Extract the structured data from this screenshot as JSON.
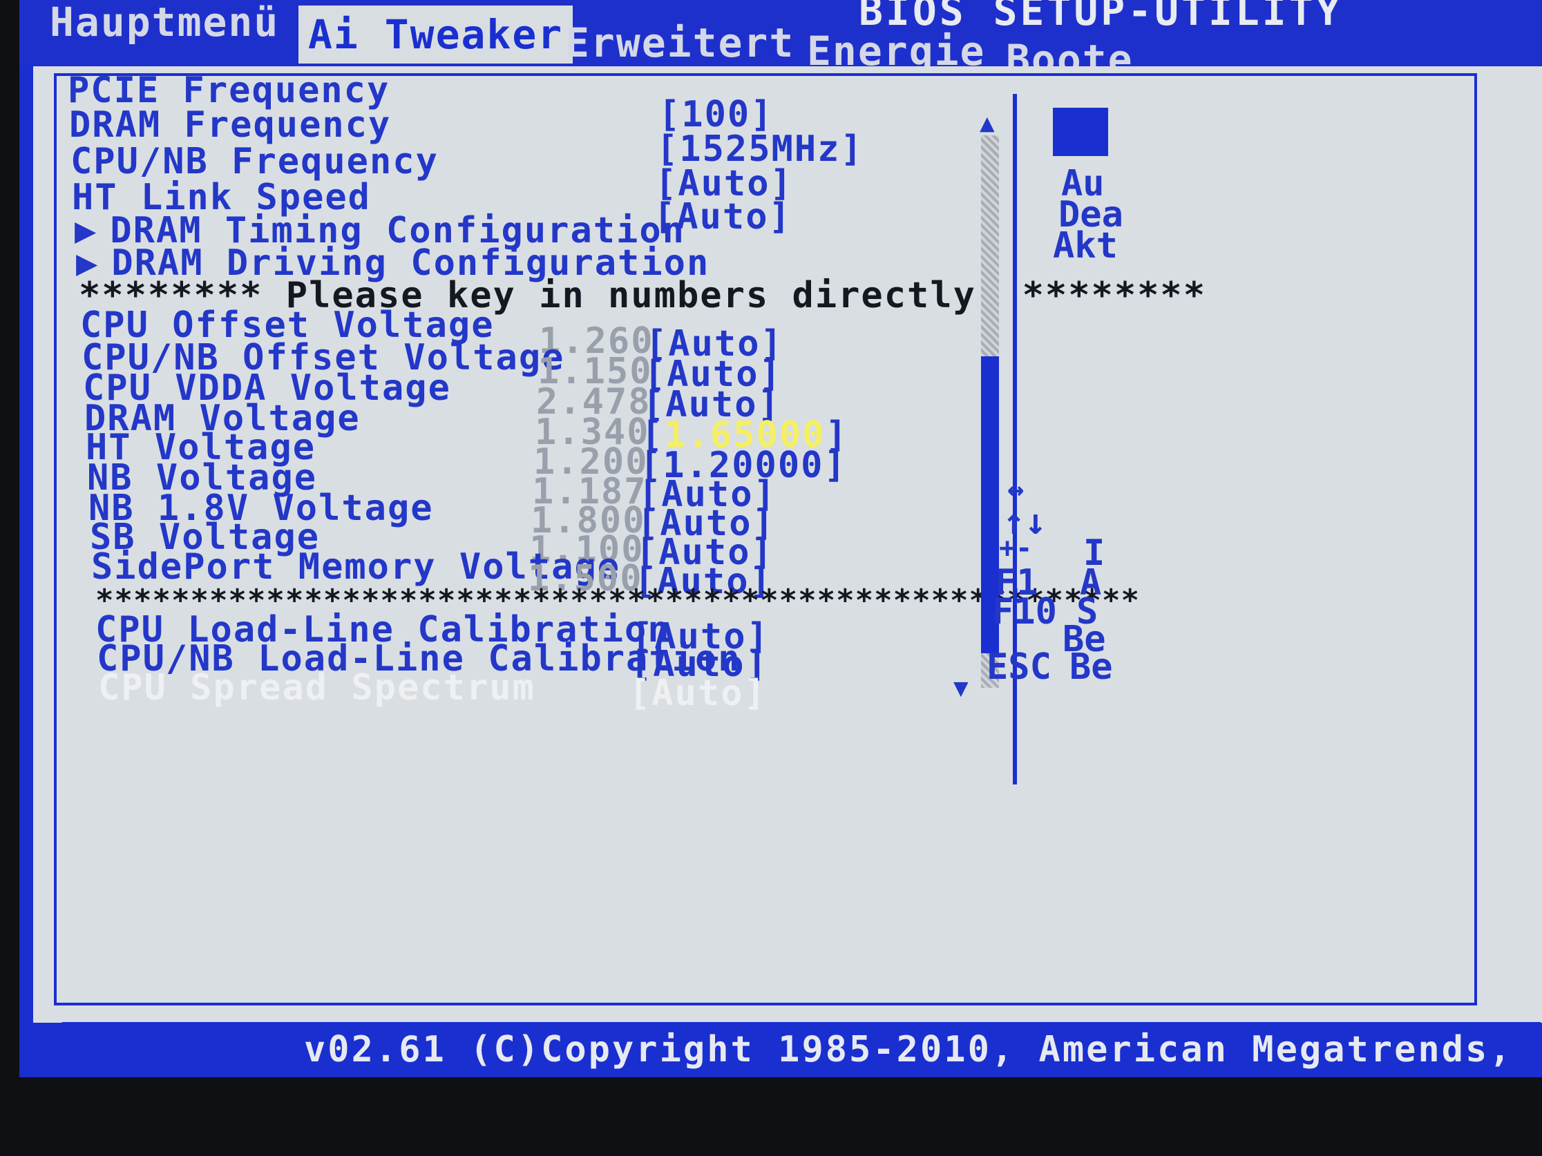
{
  "header": {
    "title": "BIOS SETUP-UTILITY",
    "tabs": [
      "Hauptmenü",
      "Ai Tweaker",
      "Erweitert",
      "Energie",
      "Boote"
    ],
    "active_tab": "Ai Tweaker"
  },
  "settings_top": [
    {
      "label": "PCIE Frequency",
      "value": "[100]"
    },
    {
      "label": "DRAM Frequency",
      "value": "[1525MHz]"
    },
    {
      "label": "CPU/NB Frequency",
      "value": "[Auto]"
    },
    {
      "label": "HT Link Speed",
      "value": "[Auto]"
    }
  ],
  "submenus": [
    {
      "arrow": "▶",
      "label": "DRAM Timing Configuration"
    },
    {
      "arrow": "▶",
      "label": "DRAM Driving Configuration"
    }
  ],
  "notice": {
    "left": "********",
    "text": "Please key in numbers directly!",
    "right": "********"
  },
  "voltages": [
    {
      "label": "CPU Offset Voltage",
      "current": "1.260",
      "value": "[Auto]"
    },
    {
      "label": "CPU/NB Offset Voltage",
      "current": "1.150",
      "value": "[Auto]"
    },
    {
      "label": "CPU VDDA Voltage",
      "current": "2.478",
      "value": "[Auto]"
    },
    {
      "label": "DRAM Voltage",
      "current": "1.340",
      "value_open": "[",
      "value_selected": "1.65000",
      "value_close": "]"
    },
    {
      "label": "HT Voltage",
      "current": "1.200",
      "value": "[1.20000]"
    },
    {
      "label": "NB Voltage",
      "current": "1.187",
      "value": "[Auto]"
    },
    {
      "label": "NB 1.8V Voltage",
      "current": "1.800",
      "value": "[Auto]"
    },
    {
      "label": "SB Voltage",
      "current": "1.100",
      "value": "[Auto]"
    },
    {
      "label": "SidePort Memory Voltage",
      "current": "1.500",
      "value": "[Auto]"
    }
  ],
  "separator": "*******************************************************",
  "settings_bottom": [
    {
      "label": "CPU Load-Line Calibration",
      "value": "[Auto]"
    },
    {
      "label": "CPU/NB Load-Line Calibration",
      "value": "[Auto]"
    },
    {
      "label": "CPU Spread Spectrum",
      "value": "[Auto]"
    }
  ],
  "side_help": {
    "lines": [
      "Au",
      "Dea",
      "Akt"
    ],
    "keys": [
      {
        "key": "↔",
        "desc": ""
      },
      {
        "key": "↑↓",
        "desc": ""
      },
      {
        "key": "+-",
        "desc": "I"
      },
      {
        "key": "F1",
        "desc": "A"
      },
      {
        "key": "F10",
        "desc": "S"
      },
      {
        "key": "",
        "desc": "Be"
      },
      {
        "key": "ESC",
        "desc": "Be"
      }
    ]
  },
  "footer": {
    "copyright": "v02.61 (C)Copyright 1985-2010, American Megatrends,"
  },
  "colors": {
    "bios_blue": "#1a2fd0",
    "panel": "#d9dee3",
    "highlight": "#f4f060"
  }
}
